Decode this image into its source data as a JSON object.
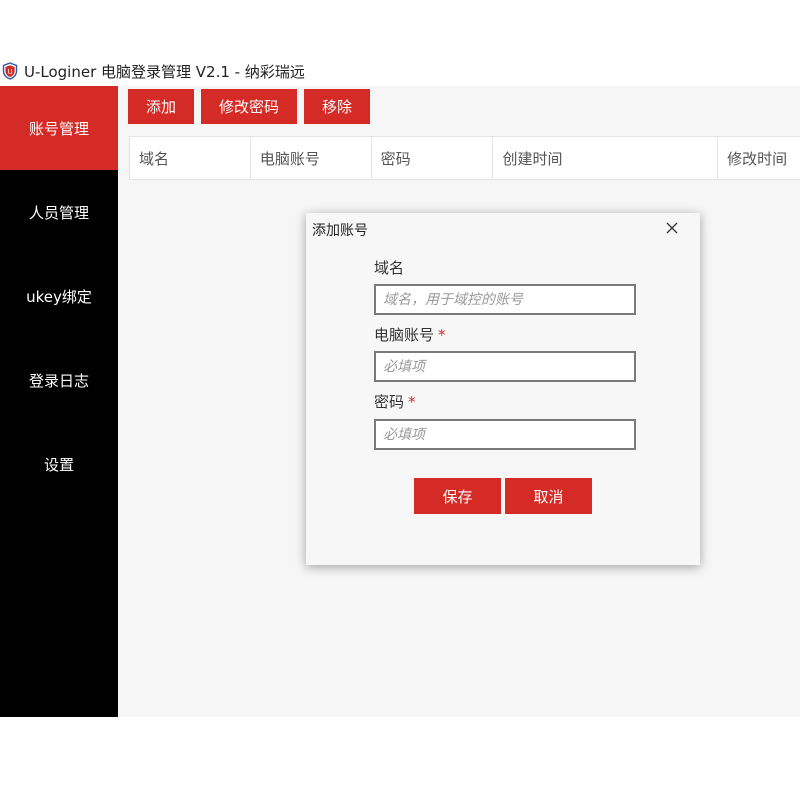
{
  "window": {
    "title": "U-Loginer 电脑登录管理 V2.1 - 纳彩瑞远",
    "app_icon": "shield-icon"
  },
  "sidebar": {
    "items": [
      {
        "label": "账号管理",
        "active": true
      },
      {
        "label": "人员管理"
      },
      {
        "label": "ukey绑定"
      },
      {
        "label": "登录日志"
      },
      {
        "label": "设置"
      }
    ]
  },
  "toolbar": {
    "add_label": "添加",
    "change_password_label": "修改密码",
    "remove_label": "移除"
  },
  "table": {
    "columns": [
      "域名",
      "电脑账号",
      "密码",
      "创建时间",
      "修改时间"
    ]
  },
  "dialog": {
    "title": "添加账号",
    "close_icon": "close-icon",
    "domain_label": "域名",
    "domain_placeholder": "域名，用于域控的账号",
    "account_label": "电脑账号",
    "account_placeholder": "必填项",
    "password_label": "密码",
    "password_placeholder": "必填项",
    "required_mark": "*",
    "save_label": "保存",
    "cancel_label": "取消"
  },
  "colors": {
    "accent": "#d42b27",
    "sidebar_bg": "#000000",
    "content_bg": "#f7f6f6"
  }
}
